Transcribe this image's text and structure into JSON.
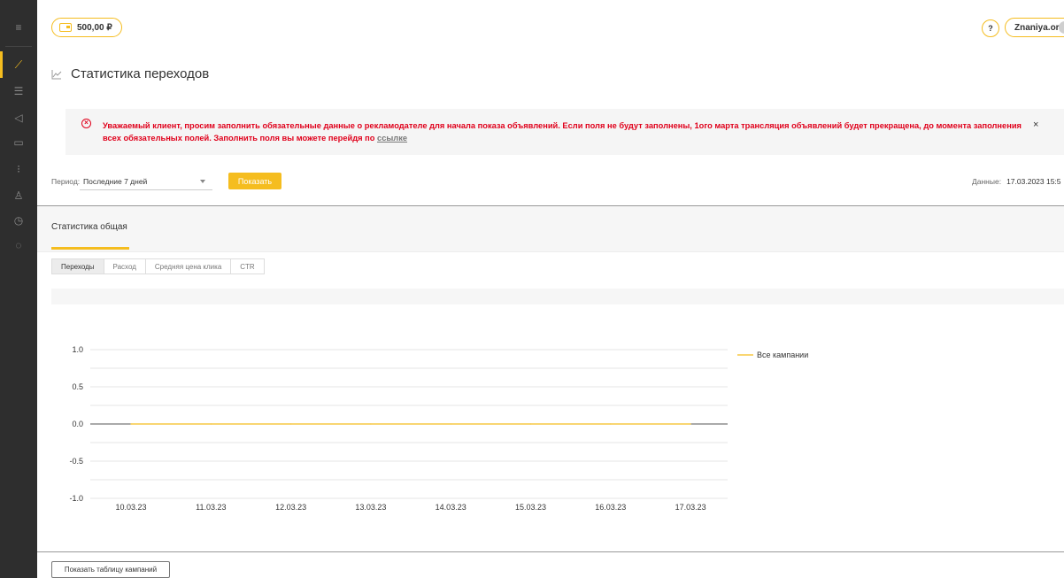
{
  "colors": {
    "accent": "#f5bd1f",
    "sidebar": "#2e2e2e",
    "alert": "#e0001b"
  },
  "sidebar": {
    "items": [
      {
        "icon": "menu-icon",
        "glyph": "≡"
      },
      {
        "icon": "chart-icon",
        "glyph": "⟋",
        "active": true
      },
      {
        "icon": "list-icon",
        "glyph": "☰"
      },
      {
        "icon": "megaphone-icon",
        "glyph": "◁"
      },
      {
        "icon": "card-icon",
        "glyph": "▭"
      },
      {
        "icon": "filter-list-icon",
        "glyph": "⁝"
      },
      {
        "icon": "users-icon",
        "glyph": "♙"
      },
      {
        "icon": "clock-icon",
        "glyph": "◷"
      },
      {
        "icon": "chat-icon",
        "glyph": "◌"
      }
    ]
  },
  "header": {
    "balance": "500,00 ₽",
    "help": "?",
    "account": "Znaniya.org"
  },
  "page": {
    "title": "Статистика переходов"
  },
  "alert": {
    "text": "Уважаемый клиент, просим заполнить обязательные данные о рекламодателе для начала показа объявлений. Если поля не будут заполнены, 1ого марта трансляция объявлений будет прекращена, до момента заполнения всех обязательных полей. Заполнить поля вы можете перейдя по ",
    "link": "ссылке",
    "close": "×"
  },
  "filters": {
    "period_label": "Период:",
    "period_value": "Последние 7 дней",
    "show_button": "Показать",
    "data_label": "Данные:",
    "data_value": "17.03.2023 15:5"
  },
  "stats": {
    "title": "Статистика общая",
    "tabs": [
      "Переходы",
      "Расход",
      "Средняя цена клика",
      "CTR"
    ],
    "active_tab": 0
  },
  "chart_data": {
    "type": "line",
    "categories": [
      "10.03.23",
      "11.03.23",
      "12.03.23",
      "13.03.23",
      "14.03.23",
      "15.03.23",
      "16.03.23",
      "17.03.23"
    ],
    "series": [
      {
        "name": "Все кампании",
        "values": [
          0,
          0,
          0,
          0,
          0,
          0,
          0,
          0
        ],
        "color": "#f5bd1f"
      }
    ],
    "yticks": [
      "1.0",
      "0.5",
      "0.0",
      "-0.5",
      "-1.0"
    ],
    "ylim": [
      -1,
      1
    ],
    "grid": true,
    "legend": "right"
  },
  "footer": {
    "table_button": "Показать таблицу кампаний"
  }
}
